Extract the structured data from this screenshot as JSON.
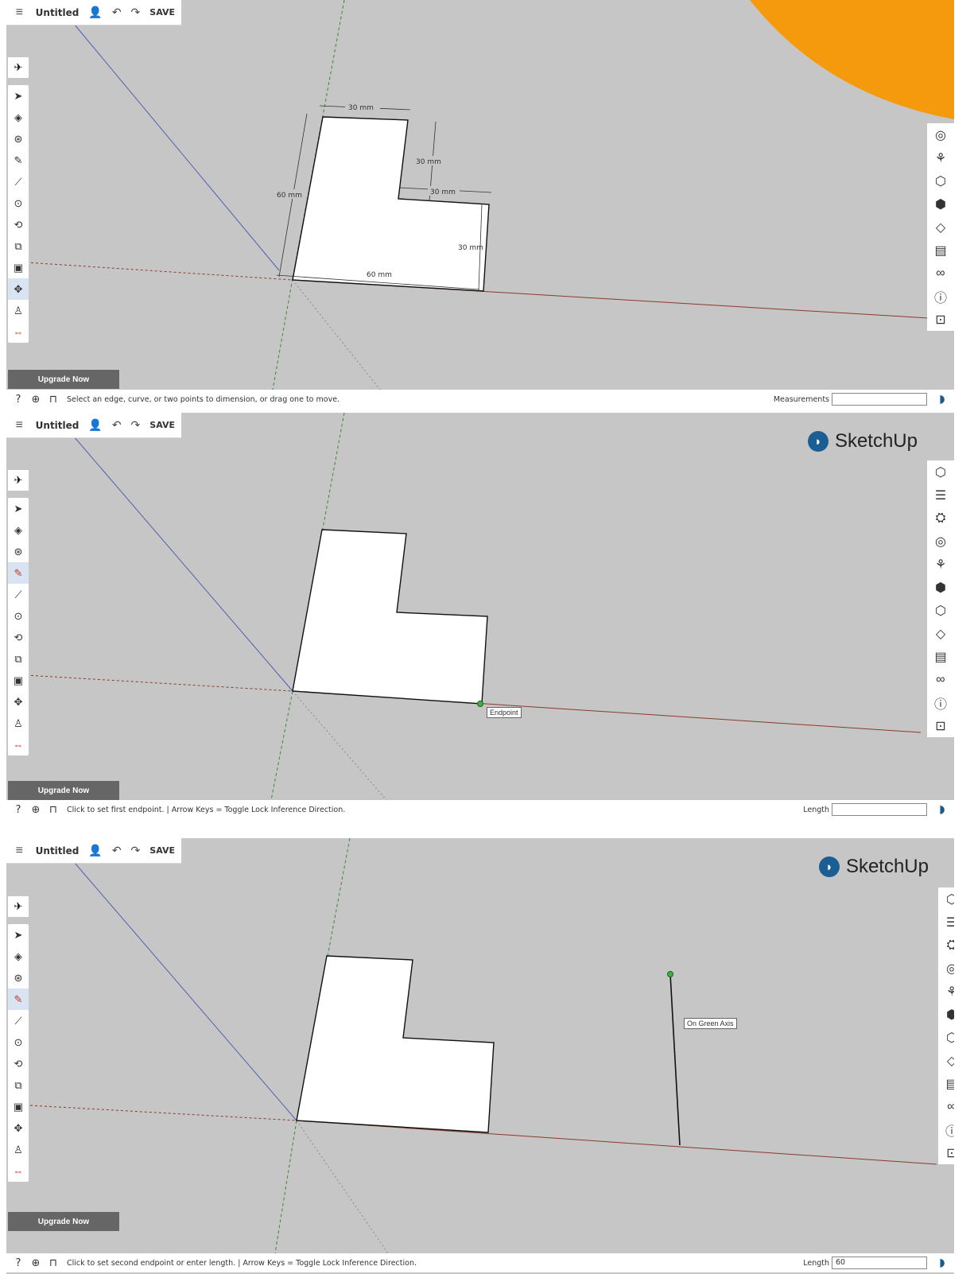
{
  "app": {
    "menu_icon": "hamburger-icon",
    "file_title": "Untitled",
    "save_label": "SAVE",
    "upgrade_label": "Upgrade Now",
    "brand_name": "SketchUp"
  },
  "left_tools": [
    {
      "name": "select-tool-icon",
      "glyph": "➤"
    },
    {
      "name": "eraser-tool-icon",
      "glyph": "◈"
    },
    {
      "name": "paint-bucket-icon",
      "glyph": "⊛"
    },
    {
      "name": "pencil-tool-icon",
      "glyph": "✎"
    },
    {
      "name": "line-tool-icon",
      "glyph": "⟋"
    },
    {
      "name": "circle-tool-icon",
      "glyph": "⊙"
    },
    {
      "name": "push-pull-icon",
      "glyph": "⟲"
    },
    {
      "name": "offset-icon",
      "glyph": "⧉"
    },
    {
      "name": "tape-measure-icon",
      "glyph": "▣"
    },
    {
      "name": "move-tool-icon",
      "glyph": "✥"
    },
    {
      "name": "walk-tool-icon",
      "glyph": "♙"
    },
    {
      "name": "orbit-tool-icon",
      "glyph": "⇔"
    }
  ],
  "right_tools": [
    "instructor-icon",
    "outliner-icon",
    "scenes-icon",
    "styles-icon",
    "components-icon",
    "materials-icon",
    "entity-info-icon",
    "tags-icon",
    "display-icon",
    "glasses-icon",
    "info-icon",
    "model-info-icon"
  ],
  "panels": [
    {
      "status_message": "Select an edge, curve, or two points to dimension, or drag one to move.",
      "measure_label": "Measurements",
      "measure_value": "",
      "dimensions": [
        "30 mm",
        "30 mm",
        "30 mm",
        "60 mm",
        "30 mm",
        "60 mm"
      ]
    },
    {
      "status_message": "Click to set first endpoint. | Arrow Keys = Toggle Lock Inference Direction.",
      "measure_label": "Length",
      "measure_value": "",
      "tooltip": "Endpoint"
    },
    {
      "status_message": "Click to set second endpoint or enter length. | Arrow Keys = Toggle Lock Inference Direction.",
      "measure_label": "Length",
      "measure_value": "60",
      "tooltip": "On Green Axis"
    }
  ],
  "colors": {
    "viewport": "#c6c6c6",
    "red_axis": "#8b3a2a",
    "green_axis": "#3c8a3c",
    "blue_axis": "#5060b0",
    "orange_overlay": "#f59a0c",
    "brand_blue": "#1b5e93"
  }
}
